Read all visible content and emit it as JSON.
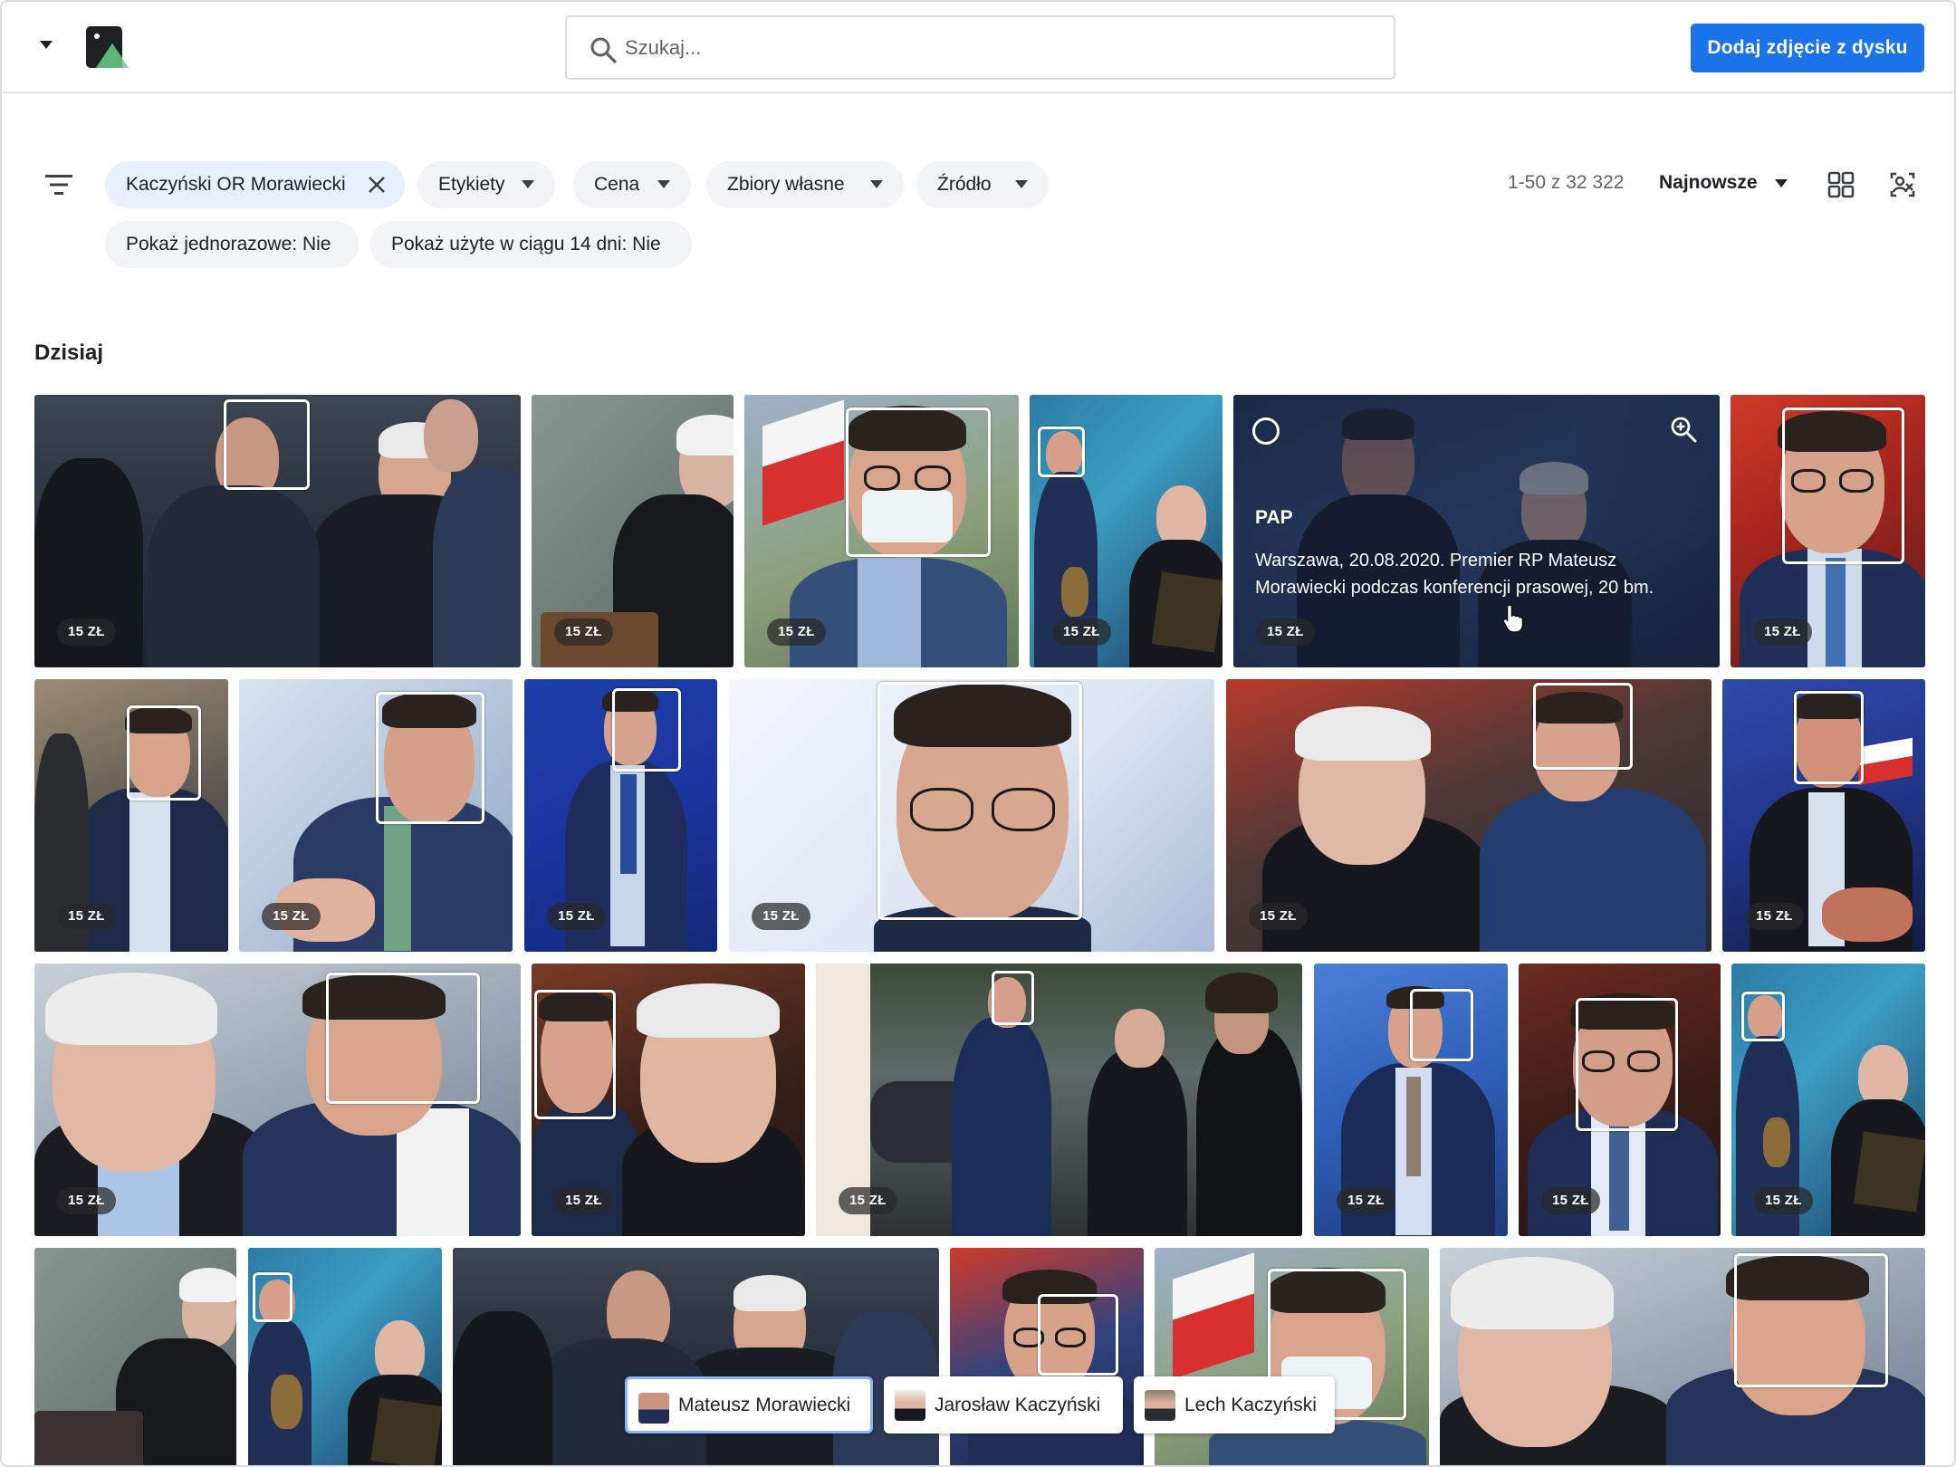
{
  "header": {
    "search_placeholder": "Szukaj...",
    "upload_button": "Dodaj zdjęcie z dysku"
  },
  "filters": {
    "chips": [
      {
        "label": "Kaczyński OR Morawiecki",
        "active": true
      },
      {
        "label": "Etykiety"
      },
      {
        "label": "Cena"
      },
      {
        "label": "Zbiory własne"
      },
      {
        "label": "Źródło"
      },
      {
        "label": "Pokaż jednorazowe: Nie"
      },
      {
        "label": "Pokaż użyte w ciągu 14 dni: Nie"
      }
    ],
    "results_count": "1-50 z 32 322",
    "sort_label": "Najnowsze"
  },
  "section": {
    "title": "Dzisiaj"
  },
  "photos": {
    "price_label": "15 ZŁ",
    "hover": {
      "source": "PAP",
      "caption": "Warszawa, 20.08.2020. Premier RP Mateusz Morawiecki podczas konferencji prasowej, 20 bm."
    }
  },
  "people_tags": [
    {
      "name": "Mateusz Morawiecki",
      "active": true
    },
    {
      "name": "Jarosław Kaczyński",
      "active": false
    },
    {
      "name": "Lech Kaczyński",
      "active": false
    }
  ],
  "colors": {
    "primary": "#1a73e8",
    "chip_bg": "#f1f3f4",
    "chip_active_bg": "#e8f0fe",
    "price_badge": "#3a3a3a"
  },
  "icons": [
    "chevron-down-icon",
    "app-logo-icon",
    "search-icon",
    "filter-icon",
    "close-icon",
    "grid-view-icon",
    "face-filter-icon",
    "zoom-in-icon",
    "pointer-cursor-icon"
  ]
}
